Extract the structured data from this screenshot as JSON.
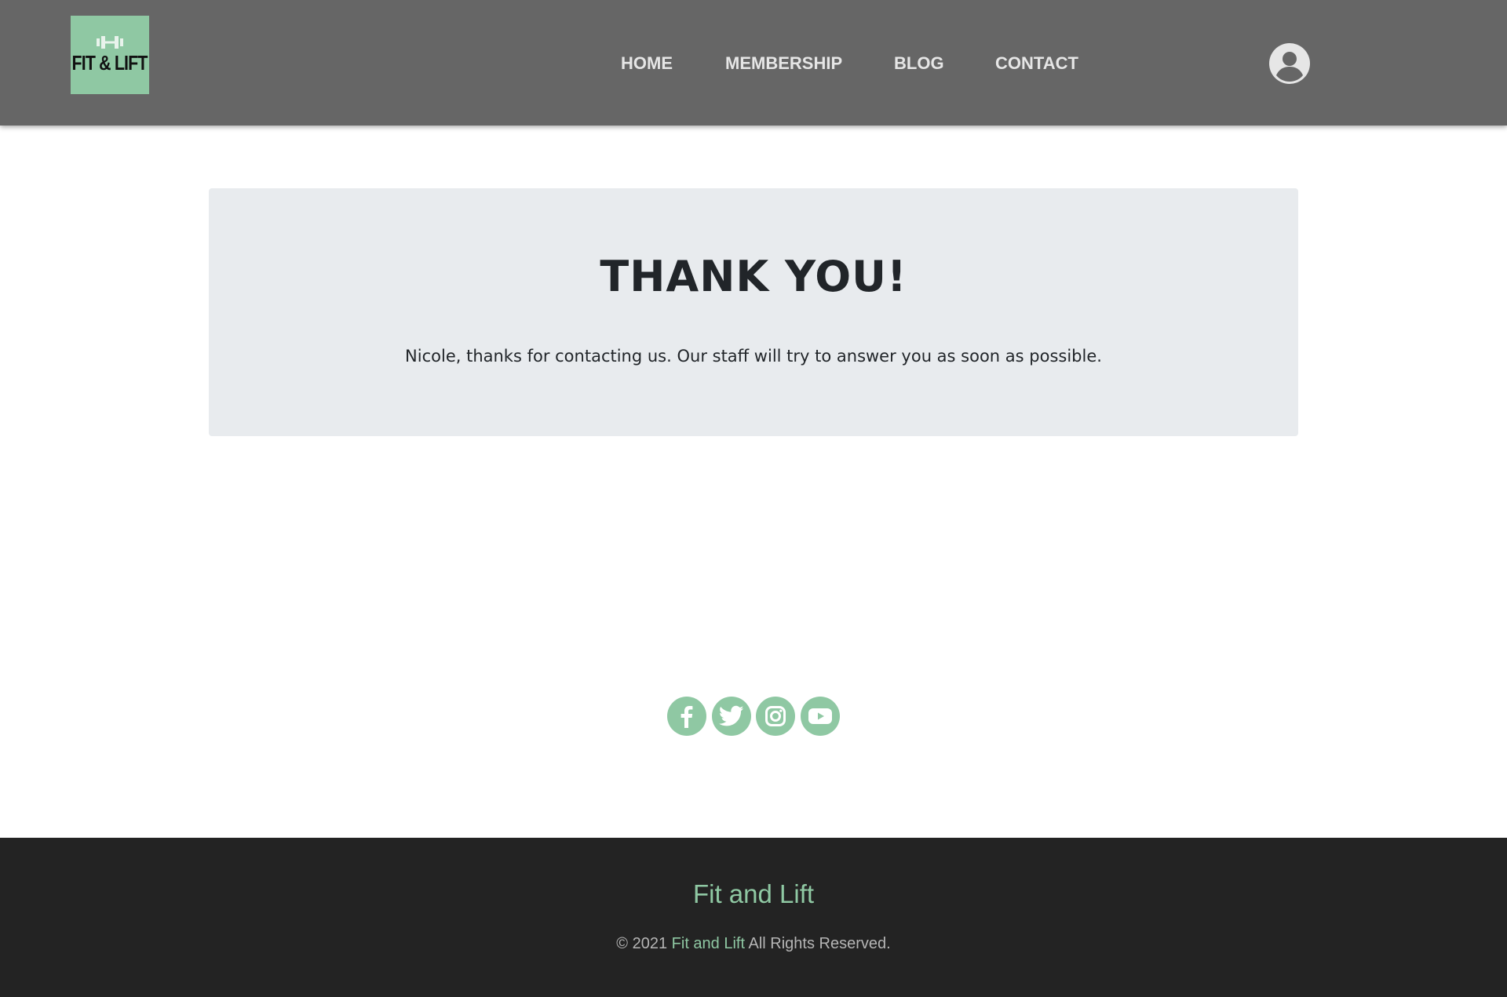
{
  "header": {
    "logo_text": "FIT & LIFT",
    "logo_icon": "dumbbell-icon",
    "nav": [
      {
        "label": "HOME"
      },
      {
        "label": "MEMBERSHIP"
      },
      {
        "label": "BLOG"
      },
      {
        "label": "CONTACT"
      }
    ],
    "account_icon": "user-account-icon"
  },
  "main": {
    "title": "THANK YOU!",
    "message": "Nicole, thanks for contacting us. Our staff will try to answer you as soon as possible."
  },
  "social": [
    {
      "icon": "facebook-icon"
    },
    {
      "icon": "twitter-icon"
    },
    {
      "icon": "instagram-icon"
    },
    {
      "icon": "youtube-icon"
    }
  ],
  "footer": {
    "title": "Fit and Lift",
    "copyright_prefix": "© 2021",
    "brand": "Fit and Lift",
    "copyright_suffix": "All Rights Reserved."
  },
  "colors": {
    "header_bg": "#666666",
    "accent": "#8fc8a3",
    "card_bg": "#e8ebee",
    "footer_bg": "#232323"
  }
}
